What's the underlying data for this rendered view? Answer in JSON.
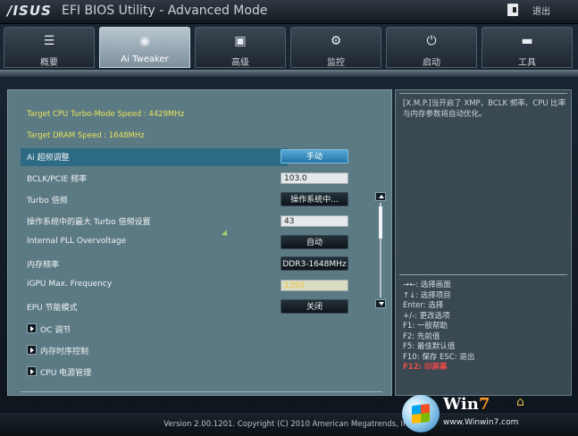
{
  "titlebar": {
    "logo": "/ISUS",
    "title": "EFI BIOS Utility - Advanced Mode",
    "exit_label": "退出"
  },
  "tabs": [
    {
      "label": "概要",
      "icon": "list-icon",
      "glyph": "☰"
    },
    {
      "label": "Ai Tweaker",
      "icon": "tweaker-icon",
      "glyph": "◉",
      "active": true
    },
    {
      "label": "高级",
      "icon": "advanced-icon",
      "glyph": "▣"
    },
    {
      "label": "监控",
      "icon": "monitor-icon",
      "glyph": "⚙"
    },
    {
      "label": "启动",
      "icon": "power-icon",
      "glyph": "⏻"
    },
    {
      "label": "工具",
      "icon": "tools-icon",
      "glyph": "▬"
    }
  ],
  "main": {
    "target_cpu": "Target CPU Turbo-Mode Speed : 4429MHz",
    "target_dram": "Target DRAM Speed : 1648MHz",
    "settings": [
      {
        "label": "Ai 超频调整",
        "type": "button",
        "value": "手动",
        "selected": true
      },
      {
        "label": "BCLK/PCIE 频率",
        "type": "input",
        "value": "103.0"
      },
      {
        "label": "Turbo 倍频",
        "type": "button",
        "value": "操作系统中..."
      },
      {
        "label": "操作系统中的最大 Turbo 倍频设置",
        "type": "input",
        "value": "43"
      },
      {
        "label": "Internal PLL Overvoltage",
        "type": "button",
        "value": "自动"
      },
      {
        "label": "内存频率",
        "type": "button",
        "value": "DDR3-1648MHz"
      },
      {
        "label": "iGPU Max. Frequency",
        "type": "input",
        "value": "1350",
        "highlight": true
      },
      {
        "label": "EPU 节能模式",
        "type": "button",
        "value": "关闭"
      }
    ],
    "submenus": [
      {
        "label": "OC 调节"
      },
      {
        "label": "内存时序控制"
      },
      {
        "label": "CPU 电源管理"
      }
    ]
  },
  "help": {
    "description": "[X.M.P.]当开启了 XMP，BCLK 频率、CPU 比率与内存参数将自动优化。",
    "keys": [
      {
        "text": "→←: 选择画面"
      },
      {
        "text": "↑↓: 选择项目"
      },
      {
        "text": "Enter: 选择"
      },
      {
        "text": "+/-: 更改选项"
      },
      {
        "text": "F1: 一般帮助"
      },
      {
        "text": "F2: 先前值"
      },
      {
        "text": "F5: 最佳默认值"
      },
      {
        "text": "F10: 保存  ESC: 退出"
      },
      {
        "text": "F12: 印屏幕",
        "highlight": true
      }
    ]
  },
  "footer": {
    "version": "Version 2.00.1201. Copyright (C) 2010 American Megatrends, Inc."
  },
  "watermark": {
    "brand_prefix": "Win",
    "brand_suffix": "7",
    "url": "www.Winwin7.com"
  },
  "colors": {
    "accent": "#2d6a84",
    "info_text": "#e6e35a",
    "panel": "#5c7a84",
    "highlight_key": "#f04a4a"
  }
}
